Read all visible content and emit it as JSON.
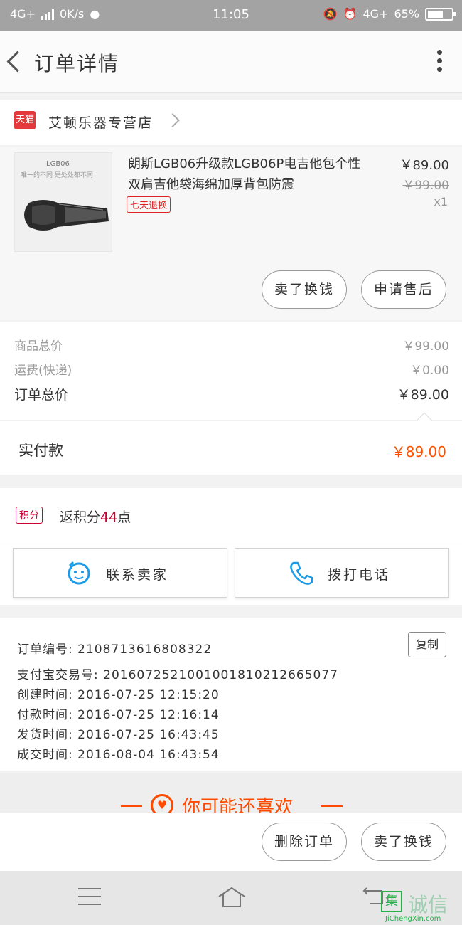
{
  "status_bar": {
    "network": "4G+",
    "speed": "0K/s",
    "time": "11:05",
    "network_right": "4G+",
    "battery": "65%",
    "battery_level": 0.65
  },
  "header": {
    "title": "订单详情"
  },
  "shop": {
    "badge": "天猫",
    "name": "艾顿乐器专营店"
  },
  "product": {
    "thumb_model": "LGB06",
    "thumb_slogan": "唯一的不同 是处处都不同",
    "name": "朗斯LGB06升级款LGB06P电吉他包个性双肩吉他袋海绵加厚背包防震",
    "tag": "七天退换",
    "price": "￥89.00",
    "original_price": "￥99.00",
    "quantity": "x1",
    "btn_resell": "卖了换钱",
    "btn_aftersale": "申请售后"
  },
  "totals": {
    "goods_label": "商品总价",
    "goods_value": "￥99.00",
    "shipping_label": "运费(快递)",
    "shipping_value": "￥0.00",
    "order_label": "订单总价",
    "order_value": "￥89.00",
    "paid_label": "实付款",
    "paid_value": "￥89.00"
  },
  "points": {
    "badge": "积分",
    "prefix": "返积分",
    "amount": "44",
    "suffix": "点"
  },
  "contact": {
    "seller": "联系卖家",
    "phone": "拨打电话"
  },
  "order_info": {
    "copy": "复制",
    "lines": [
      "订单编号: 2108713616808322",
      "支付宝交易号: 2016072521001001810212665077",
      "创建时间: 2016-07-25 12:15:20",
      "付款时间: 2016-07-25 12:16:14",
      "发货时间: 2016-07-25 16:43:45",
      "成交时间: 2016-08-04 16:43:54"
    ]
  },
  "recommend": {
    "title": "你可能还喜欢"
  },
  "actions": {
    "delete": "删除订单",
    "resell": "卖了换钱"
  },
  "watermark": {
    "char": "集",
    "brand": "诚信",
    "url": "JiChengXin.com"
  },
  "colors": {
    "accent": "#ff5000",
    "tmall_red": "#e4393c",
    "points_red": "#cc0033",
    "contact_blue": "#1a9be8"
  }
}
